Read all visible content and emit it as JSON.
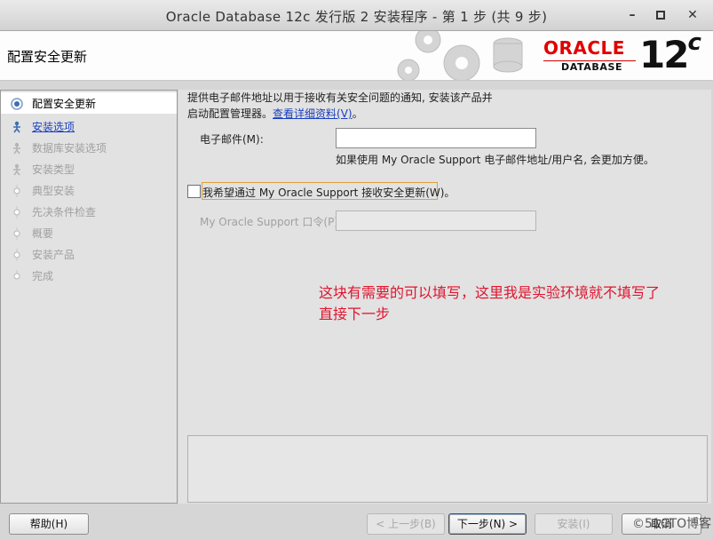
{
  "window": {
    "title": "Oracle Database 12c 发行版 2 安装程序 - 第 1 步 (共 9 步)",
    "minimize_glyph": "–",
    "maximize_glyph": "▫",
    "close_glyph": "✕"
  },
  "header": {
    "page_title": "配置安全更新",
    "logo_oracle": "ORACLE",
    "logo_database": "DATABASE",
    "logo_version": "12",
    "logo_version_suffix": "c"
  },
  "sidebar": {
    "steps": [
      {
        "label": "配置安全更新",
        "state": "active"
      },
      {
        "label": "安装选项",
        "state": "link"
      },
      {
        "label": "数据库安装选项",
        "state": "disabled"
      },
      {
        "label": "安装类型",
        "state": "disabled"
      },
      {
        "label": "典型安装",
        "state": "disabled"
      },
      {
        "label": "先决条件检查",
        "state": "disabled"
      },
      {
        "label": "概要",
        "state": "disabled"
      },
      {
        "label": "安装产品",
        "state": "disabled"
      },
      {
        "label": "完成",
        "state": "disabled"
      }
    ]
  },
  "main": {
    "description_line1": "提供电子邮件地址以用于接收有关安全问题的通知, 安装该产品并",
    "description_line2": "启动配置管理器。",
    "details_link": "查看详细资料(V)",
    "details_link_suffix": "。",
    "email_label": "电子邮件(M):",
    "email_value": "",
    "email_hint": "如果使用 My Oracle Support 电子邮件地址/用户名, 会更加方便。",
    "checkbox_label": "我希望通过 My Oracle Support 接收安全更新(W)。",
    "checkbox_checked": false,
    "password_label": "My Oracle Support 口令(P):",
    "password_value": "",
    "annotation_line1": "这块有需要的可以填写，这里我是实验环境就不填写了",
    "annotation_line2": "直接下一步",
    "annotation_color": "#e0142e"
  },
  "footer": {
    "help_button": "帮助(H)",
    "back_button": "< 上一步(B)",
    "next_button": "下一步(N) >",
    "install_button": "安装(I)",
    "cancel_button": "取消",
    "watermark": "©51CTO博客"
  }
}
